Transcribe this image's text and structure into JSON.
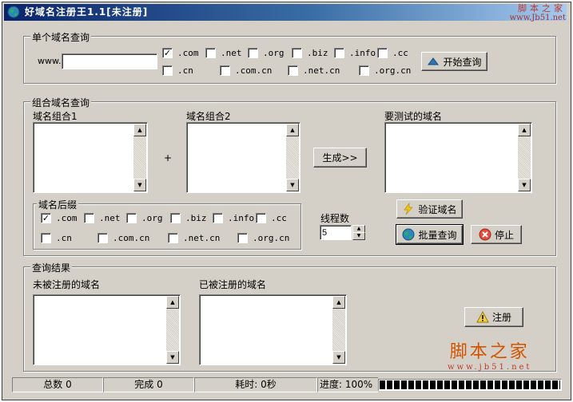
{
  "window": {
    "title": "好域名注册王1.1[未注册]",
    "watermark_top_text": "脚本之家",
    "watermark_top_url": "www.Jb51.net"
  },
  "single_query": {
    "legend": "单个域名查询",
    "prefix_label": "www.",
    "domain_value": "",
    "suffixes": [
      {
        "label": ".com",
        "checked": true
      },
      {
        "label": ".net",
        "checked": false
      },
      {
        "label": ".org",
        "checked": false
      },
      {
        "label": ".biz",
        "checked": false
      },
      {
        "label": ".info",
        "checked": false
      },
      {
        "label": ".cc",
        "checked": false
      },
      {
        "label": ".cn",
        "checked": false
      },
      {
        "label": ".com.cn",
        "checked": false
      },
      {
        "label": ".net.cn",
        "checked": false
      },
      {
        "label": ".org.cn",
        "checked": false
      }
    ],
    "start_button": "开始查询"
  },
  "combo_query": {
    "legend": "组合域名查询",
    "combo1_label": "域名组合1",
    "combo2_label": "域名组合2",
    "plus_label": "+",
    "generate_button": "生成>>",
    "to_test_label": "要测试的域名",
    "suffix_legend": "域名后缀",
    "suffixes": [
      {
        "label": ".com",
        "checked": true
      },
      {
        "label": ".net",
        "checked": false
      },
      {
        "label": ".org",
        "checked": false
      },
      {
        "label": ".biz",
        "checked": false
      },
      {
        "label": ".info",
        "checked": false
      },
      {
        "label": ".cc",
        "checked": false
      },
      {
        "label": ".cn",
        "checked": false
      },
      {
        "label": ".com.cn",
        "checked": false
      },
      {
        "label": ".net.cn",
        "checked": false
      },
      {
        "label": ".org.cn",
        "checked": false
      }
    ],
    "threads_label": "线程数",
    "threads_value": "5",
    "verify_button": "验证域名",
    "batch_button": "批量查询",
    "stop_button": "停止"
  },
  "results": {
    "legend": "查询结果",
    "unregistered_label": "未被注册的域名",
    "registered_label": "已被注册的域名",
    "register_button": "注册"
  },
  "status": {
    "total": "总数  0",
    "done": "完成  0",
    "elapsed": "耗时: 0秒",
    "progress_label": "进度: 100%",
    "progress_fraction": 1.0
  },
  "watermark_bottom": {
    "text": "脚本之家",
    "url": "www.jb51.net"
  }
}
